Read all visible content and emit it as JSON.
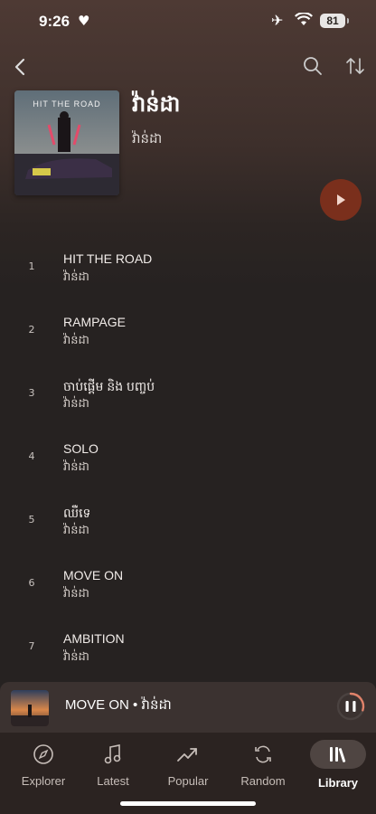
{
  "status": {
    "time": "9:26",
    "battery": "81"
  },
  "album": {
    "title": "វ៉ាន់ដា",
    "artist": "វ៉ាន់ដា",
    "cover_text": "HIT THE ROAD"
  },
  "tracks": [
    {
      "num": "1",
      "name": "HIT THE ROAD",
      "artist": "វ៉ាន់ដា"
    },
    {
      "num": "2",
      "name": "RAMPAGE",
      "artist": "វ៉ាន់ដា"
    },
    {
      "num": "3",
      "name": "ចាប់ផ្ដើម និង បញ្ចប់",
      "artist": "វ៉ាន់ដា"
    },
    {
      "num": "4",
      "name": "SOLO",
      "artist": "វ៉ាន់ដា"
    },
    {
      "num": "5",
      "name": "ឈឺទេ",
      "artist": "វ៉ាន់ដា"
    },
    {
      "num": "6",
      "name": "MOVE ON",
      "artist": "វ៉ាន់ដា"
    },
    {
      "num": "7",
      "name": "AMBITION",
      "artist": "វ៉ាន់ដា"
    }
  ],
  "now_playing": {
    "text": "MOVE ON • វ៉ាន់ដា",
    "progress": 0.3
  },
  "tabs": [
    {
      "label": "Explorer",
      "icon": "compass-icon"
    },
    {
      "label": "Latest",
      "icon": "music-note-icon"
    },
    {
      "label": "Popular",
      "icon": "trending-up-icon"
    },
    {
      "label": "Random",
      "icon": "shuffle-icon"
    },
    {
      "label": "Library",
      "icon": "library-icon",
      "active": true
    }
  ],
  "colors": {
    "accent": "#7a2f1c",
    "background": "#262221"
  }
}
